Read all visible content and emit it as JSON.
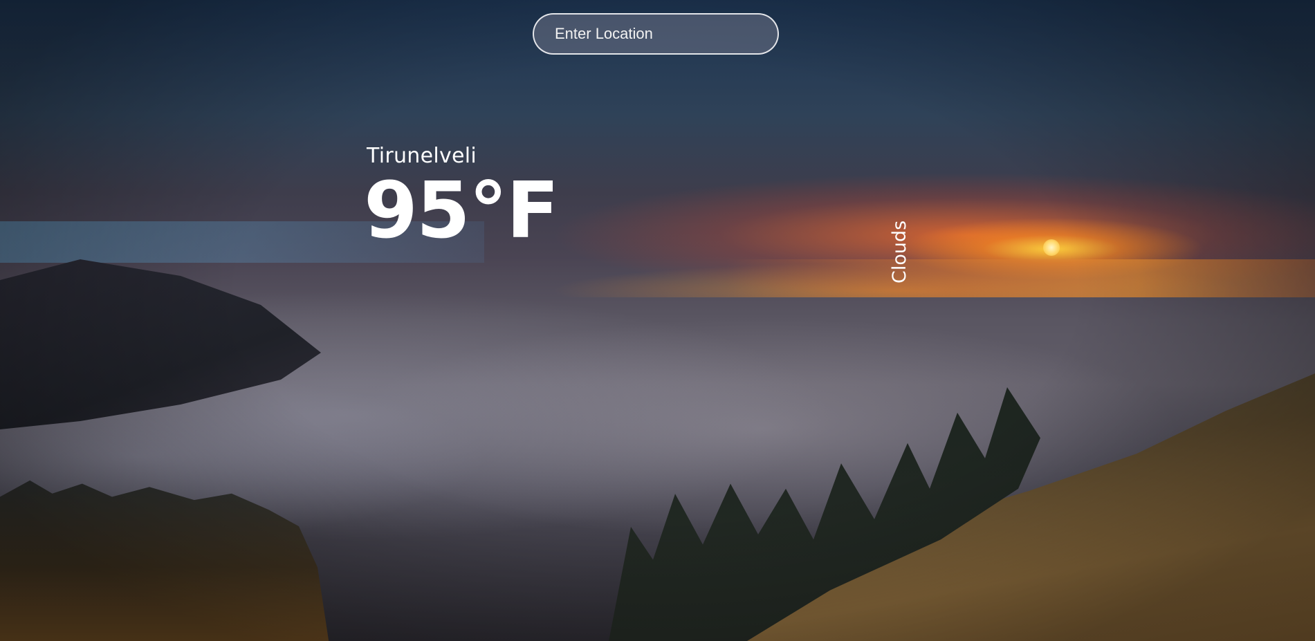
{
  "search": {
    "placeholder": "Enter Location",
    "value": ""
  },
  "weather": {
    "city": "Tirunelveli",
    "temperature": "95°F",
    "condition": "Clouds"
  },
  "background": {
    "scene": "sunset-over-fog-landscape"
  }
}
